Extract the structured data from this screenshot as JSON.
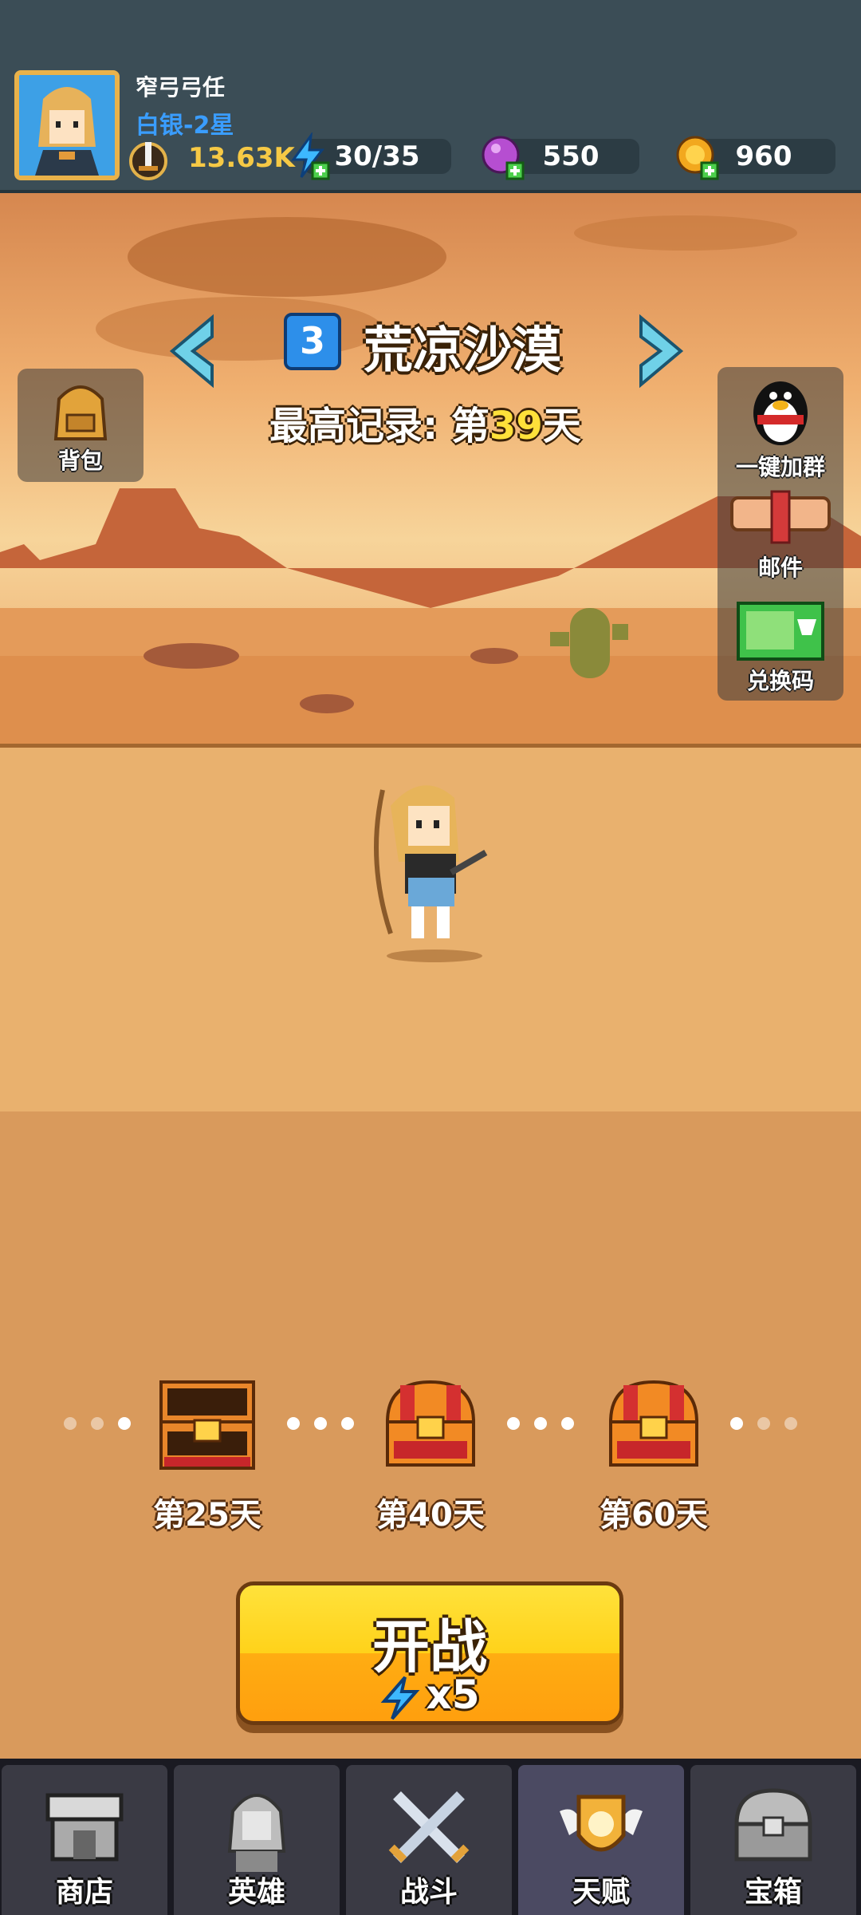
{
  "player": {
    "name": "窄弓弓任",
    "rank": "白银-2星",
    "power": "13.63K"
  },
  "resources": {
    "energy": "30/35",
    "gems": "550",
    "gold": "960"
  },
  "stage": {
    "number": "3",
    "name": "荒凉沙漠",
    "record_prefix": "最高记录: 第",
    "record_day": "39",
    "record_suffix": "天"
  },
  "side_left": {
    "backpack_label": "背包"
  },
  "side_right": {
    "group_label": "一键加群",
    "mail_label": "邮件",
    "redeem_label": "兑换码"
  },
  "milestones": [
    {
      "label": "第25天",
      "state": "opened"
    },
    {
      "label": "第40天",
      "state": "locked"
    },
    {
      "label": "第60天",
      "state": "locked"
    }
  ],
  "fight": {
    "label": "开战",
    "cost": "x5"
  },
  "nav": [
    {
      "label": "商店",
      "icon": "shop-icon"
    },
    {
      "label": "英雄",
      "icon": "hero-icon"
    },
    {
      "label": "战斗",
      "icon": "battle-icon"
    },
    {
      "label": "天赋",
      "icon": "talent-icon"
    },
    {
      "label": "宝箱",
      "icon": "chest-icon"
    }
  ],
  "colors": {
    "topbar": "#3b4d56",
    "accent_blue": "#2d8fea",
    "record_highlight": "#ffe13a",
    "fight_button": "#ffd21a",
    "sand": "#e9b16e"
  }
}
